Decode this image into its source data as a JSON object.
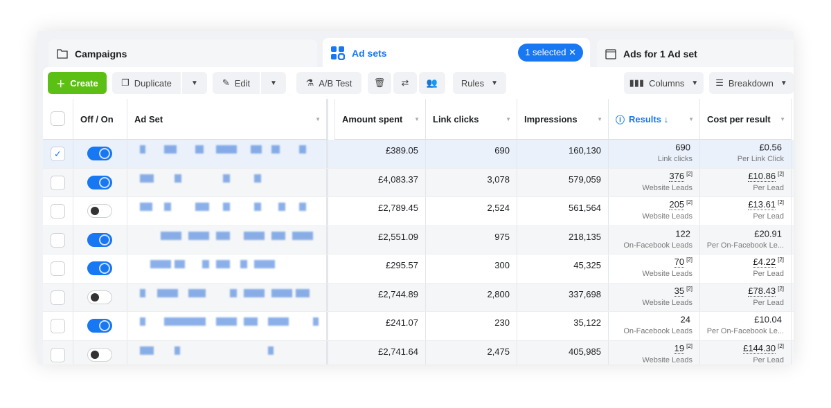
{
  "tabs": {
    "campaigns": "Campaigns",
    "adsets": "Ad sets",
    "selected_badge": "1 selected",
    "ads": "Ads for 1 Ad set"
  },
  "toolbar": {
    "create": "Create",
    "duplicate": "Duplicate",
    "edit": "Edit",
    "ab_test": "A/B Test",
    "rules": "Rules",
    "columns": "Columns",
    "breakdown": "Breakdown"
  },
  "columns": {
    "toggle": "Off / On",
    "adset": "Ad Set",
    "amount": "Amount spent",
    "clicks": "Link clicks",
    "impressions": "Impressions",
    "results": "Results ↓",
    "cost": "Cost per result"
  },
  "rows": [
    {
      "selected": true,
      "on": true,
      "amount": "£389.05",
      "clicks": "690",
      "impressions": "160,130",
      "result": "690",
      "result_type": "Link clicks",
      "result_note": "",
      "cost": "£0.56",
      "cost_type": "Per Link Click",
      "cost_note": ""
    },
    {
      "selected": false,
      "on": true,
      "amount": "£4,083.37",
      "clicks": "3,078",
      "impressions": "579,059",
      "result": "376",
      "result_type": "Website Leads",
      "result_note": "[2]",
      "cost": "£10.86",
      "cost_type": "Per Lead",
      "cost_note": "[2]"
    },
    {
      "selected": false,
      "on": false,
      "amount": "£2,789.45",
      "clicks": "2,524",
      "impressions": "561,564",
      "result": "205",
      "result_type": "Website Leads",
      "result_note": "[2]",
      "cost": "£13.61",
      "cost_type": "Per Lead",
      "cost_note": "[2]"
    },
    {
      "selected": false,
      "on": true,
      "amount": "£2,551.09",
      "clicks": "975",
      "impressions": "218,135",
      "result": "122",
      "result_type": "On-Facebook Leads",
      "result_note": "",
      "cost": "£20.91",
      "cost_type": "Per On-Facebook Le...",
      "cost_note": ""
    },
    {
      "selected": false,
      "on": true,
      "amount": "£295.57",
      "clicks": "300",
      "impressions": "45,325",
      "result": "70",
      "result_type": "Website Leads",
      "result_note": "[2]",
      "cost": "£4.22",
      "cost_type": "Per Lead",
      "cost_note": "[2]"
    },
    {
      "selected": false,
      "on": false,
      "amount": "£2,744.89",
      "clicks": "2,800",
      "impressions": "337,698",
      "result": "35",
      "result_type": "Website Leads",
      "result_note": "[2]",
      "cost": "£78.43",
      "cost_type": "Per Lead",
      "cost_note": "[2]"
    },
    {
      "selected": false,
      "on": true,
      "amount": "£241.07",
      "clicks": "230",
      "impressions": "35,122",
      "result": "24",
      "result_type": "On-Facebook Leads",
      "result_note": "",
      "cost": "£10.04",
      "cost_type": "Per On-Facebook Le...",
      "cost_note": ""
    },
    {
      "selected": false,
      "on": false,
      "amount": "£2,741.64",
      "clicks": "2,475",
      "impressions": "405,985",
      "result": "19",
      "result_type": "Website Leads",
      "result_note": "[2]",
      "cost": "£144.30",
      "cost_type": "Per Lead",
      "cost_note": "[2]"
    }
  ]
}
